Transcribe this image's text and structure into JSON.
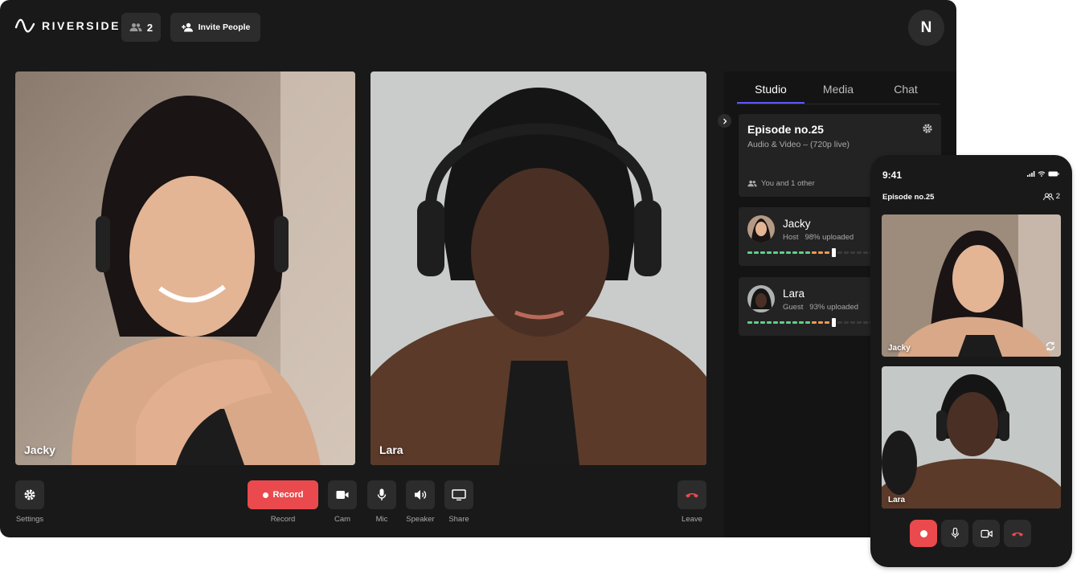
{
  "header": {
    "brand": "RIVERSIDE",
    "participant_count": "2",
    "invite_label": "Invite People",
    "user_initial": "N"
  },
  "videos": [
    {
      "name": "Jacky"
    },
    {
      "name": "Lara"
    }
  ],
  "controls": {
    "settings": "Settings",
    "record_button": "Record",
    "record": "Record",
    "cam": "Cam",
    "mic": "Mic",
    "speaker": "Speaker",
    "share": "Share",
    "leave": "Leave"
  },
  "panel": {
    "tabs": [
      "Studio",
      "Media",
      "Chat"
    ],
    "active_tab": "Studio",
    "episode": {
      "title": "Episode no.25",
      "subtitle": "Audio & Video – (720p live)",
      "participants": "You and 1 other"
    },
    "participants": [
      {
        "name": "Jacky",
        "role": "Host",
        "upload": "98% uploaded",
        "upload_fraction": 0.98
      },
      {
        "name": "Lara",
        "role": "Guest",
        "upload": "93% uploaded",
        "upload_fraction": 0.93
      }
    ]
  },
  "phone": {
    "time": "9:41",
    "episode": "Episode no.25",
    "count": "2",
    "videos": [
      {
        "name": "Jacky"
      },
      {
        "name": "Lara"
      }
    ]
  },
  "colors": {
    "accent": "#5f57ff",
    "record_red": "#ea4a4d",
    "meter_green": "#5fd08b",
    "meter_orange": "#f39a4b"
  }
}
